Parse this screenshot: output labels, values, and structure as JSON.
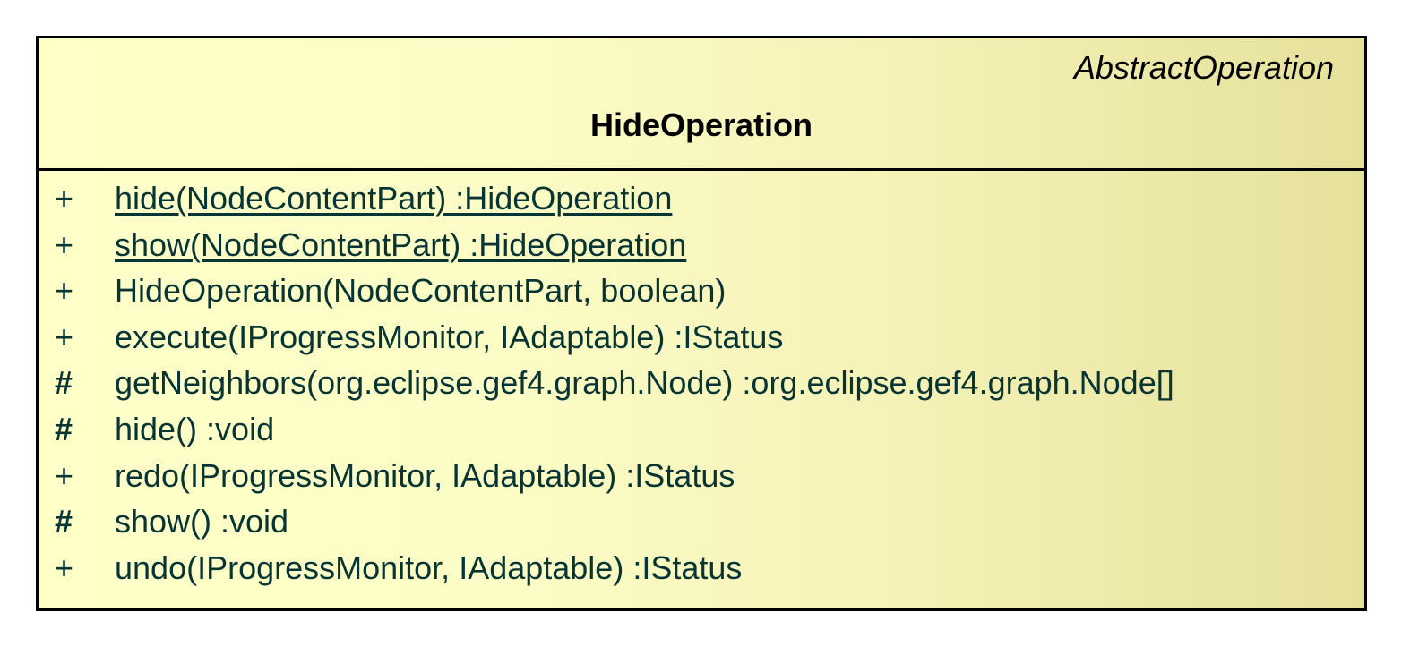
{
  "class": {
    "stereotype": "AbstractOperation",
    "name": "HideOperation"
  },
  "colors": {
    "border": "#000000",
    "fill_light": "#ffffc8",
    "fill_dark": "#e5e19b",
    "text": "#073535"
  },
  "operations": [
    {
      "visibility": "+",
      "signature": "hide(NodeContentPart)  :HideOperation",
      "static": true
    },
    {
      "visibility": "+",
      "signature": "show(NodeContentPart)  :HideOperation",
      "static": true
    },
    {
      "visibility": "+",
      "signature": "HideOperation(NodeContentPart, boolean)",
      "static": false
    },
    {
      "visibility": "+",
      "signature": "execute(IProgressMonitor, IAdaptable)  :IStatus",
      "static": false
    },
    {
      "visibility": "#",
      "signature": "getNeighbors(org.eclipse.gef4.graph.Node)  :org.eclipse.gef4.graph.Node[]",
      "static": false
    },
    {
      "visibility": "#",
      "signature": "hide()  :void",
      "static": false
    },
    {
      "visibility": "+",
      "signature": "redo(IProgressMonitor, IAdaptable)  :IStatus",
      "static": false
    },
    {
      "visibility": "#",
      "signature": "show()  :void",
      "static": false
    },
    {
      "visibility": "+",
      "signature": "undo(IProgressMonitor, IAdaptable)  :IStatus",
      "static": false
    }
  ]
}
